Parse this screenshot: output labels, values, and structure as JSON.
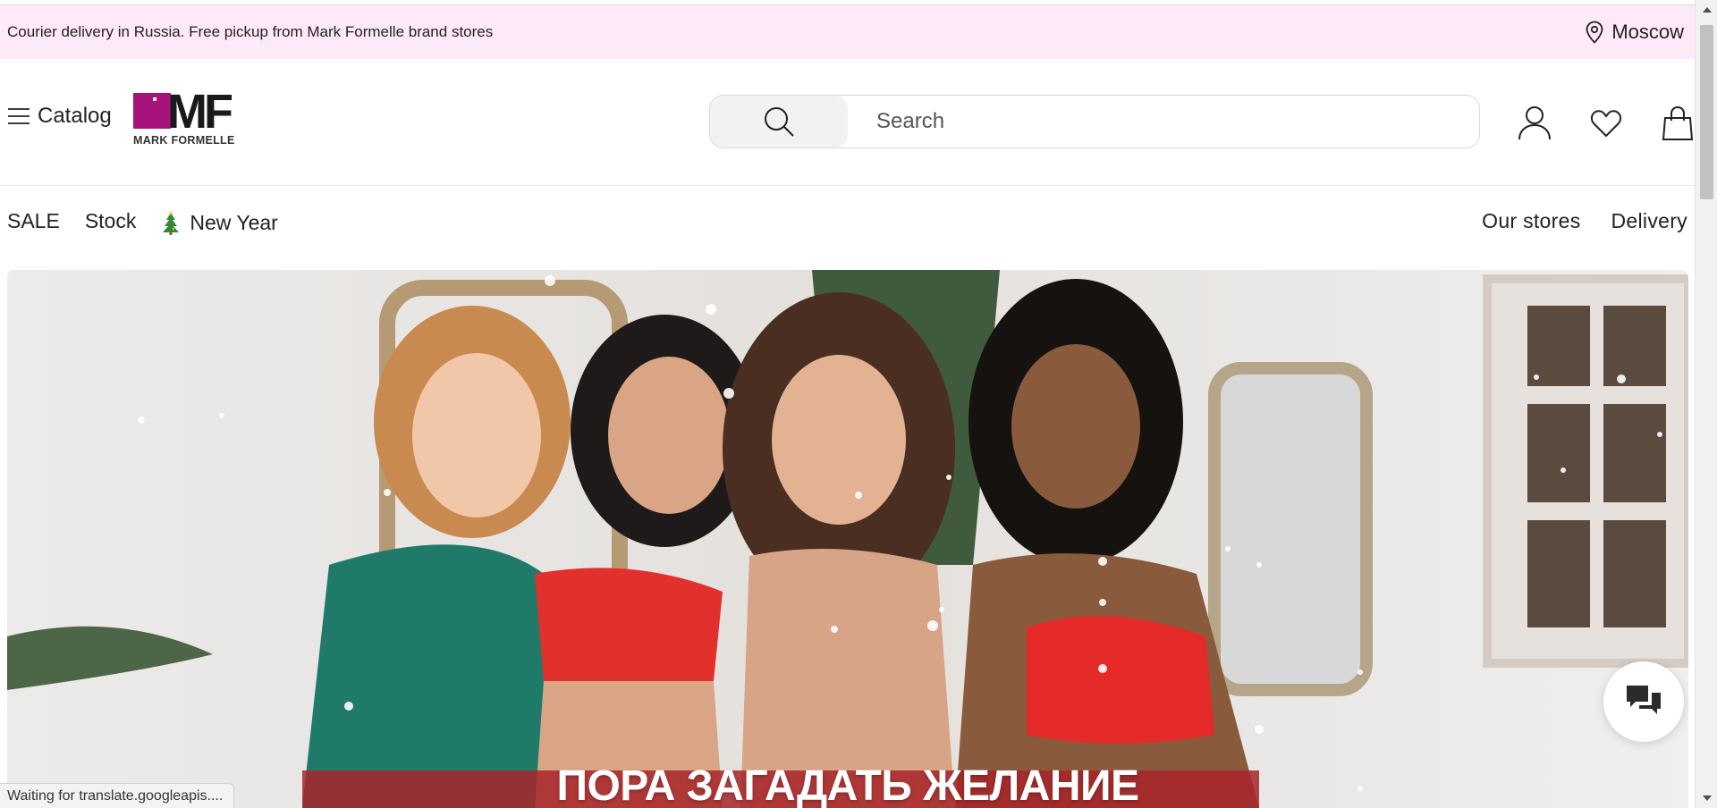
{
  "promo": {
    "text": "Courier delivery in Russia. Free pickup from Mark Formelle brand stores",
    "city": "Moscow",
    "city_icon": "location-pin-icon"
  },
  "header": {
    "catalog_label": "Catalog",
    "logo": {
      "mark": "MF",
      "subtitle": "MARK FORMELLE",
      "brand_color": "#a7137a"
    },
    "search": {
      "placeholder": "Search",
      "value": ""
    },
    "icons": [
      "account-icon",
      "favorites-heart-icon",
      "cart-bag-icon"
    ]
  },
  "nav": {
    "left": [
      {
        "label": "SALE"
      },
      {
        "label": "Stock"
      },
      {
        "label": "New Year",
        "icon": "christmas-tree-icon"
      }
    ],
    "right": [
      {
        "label": "Our stores"
      },
      {
        "label": "Delivery"
      }
    ]
  },
  "hero": {
    "caption": "ПОРА ЗАГАДАТЬ ЖЕЛАНИЕ"
  },
  "status_bar": "Waiting for translate.googleapis....",
  "colors": {
    "promo_bg": "#fde9f7",
    "accent": "#a7137a"
  }
}
